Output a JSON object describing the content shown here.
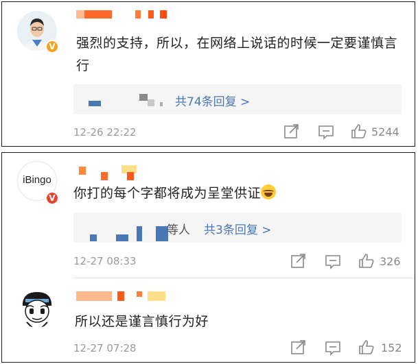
{
  "comments": [
    {
      "text": "强烈的支持，所以，在网络上说话的时候一定要谨慎言行",
      "replies_link": "共74条回复 >",
      "replies_prefix": "",
      "time": "12-26 22:22",
      "likes": "5244",
      "badge": "V"
    },
    {
      "avatar_text": "iBingo",
      "text": "你打的每个字都将成为呈堂供证",
      "replies_link": "共3条回复 >",
      "replies_prefix": "等人",
      "time": "12-27 08:33",
      "likes": "326",
      "badge": "V"
    },
    {
      "text": "所以还是谨言慎行为好",
      "time": "12-27 07:28",
      "likes": "152"
    }
  ],
  "colors": {
    "link": "#4a78b4",
    "badge_orange": "#f7a21b",
    "badge_red": "#e8452c",
    "meta": "#999999"
  },
  "icons": [
    "share-icon",
    "comment-icon",
    "like-icon"
  ]
}
